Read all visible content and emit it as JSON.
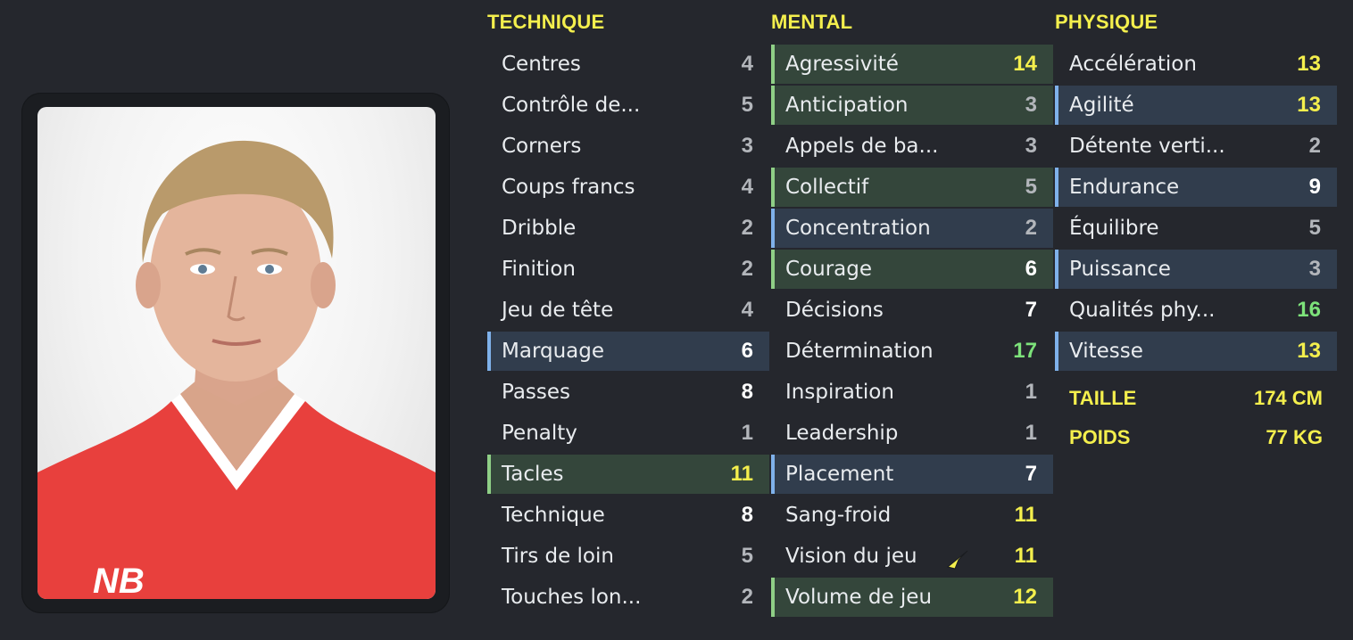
{
  "technique": {
    "title": "TECHNIQUE",
    "attributes": [
      {
        "label": "Centres",
        "value": "4",
        "tone": "gray",
        "hl": ""
      },
      {
        "label": "Contrôle de...",
        "value": "5",
        "tone": "gray",
        "hl": ""
      },
      {
        "label": "Corners",
        "value": "3",
        "tone": "gray",
        "hl": ""
      },
      {
        "label": "Coups francs",
        "value": "4",
        "tone": "gray",
        "hl": ""
      },
      {
        "label": "Dribble",
        "value": "2",
        "tone": "gray",
        "hl": ""
      },
      {
        "label": "Finition",
        "value": "2",
        "tone": "gray",
        "hl": ""
      },
      {
        "label": "Jeu de tête",
        "value": "4",
        "tone": "gray",
        "hl": ""
      },
      {
        "label": "Marquage",
        "value": "6",
        "tone": "white",
        "hl": "blue"
      },
      {
        "label": "Passes",
        "value": "8",
        "tone": "white",
        "hl": ""
      },
      {
        "label": "Penalty",
        "value": "1",
        "tone": "gray",
        "hl": ""
      },
      {
        "label": "Tacles",
        "value": "11",
        "tone": "yellow",
        "hl": "green"
      },
      {
        "label": "Technique",
        "value": "8",
        "tone": "white",
        "hl": ""
      },
      {
        "label": "Tirs de loin",
        "value": "5",
        "tone": "gray",
        "hl": ""
      },
      {
        "label": "Touches lon...",
        "value": "2",
        "tone": "gray",
        "hl": ""
      }
    ]
  },
  "mental": {
    "title": "MENTAL",
    "attributes": [
      {
        "label": "Agressivité",
        "value": "14",
        "tone": "yellow",
        "hl": "green"
      },
      {
        "label": "Anticipation",
        "value": "3",
        "tone": "gray",
        "hl": "green"
      },
      {
        "label": "Appels de ba...",
        "value": "3",
        "tone": "gray",
        "hl": ""
      },
      {
        "label": "Collectif",
        "value": "5",
        "tone": "gray",
        "hl": "green"
      },
      {
        "label": "Concentration",
        "value": "2",
        "tone": "gray",
        "hl": "blue"
      },
      {
        "label": "Courage",
        "value": "6",
        "tone": "white",
        "hl": "green"
      },
      {
        "label": "Décisions",
        "value": "7",
        "tone": "white",
        "hl": ""
      },
      {
        "label": "Détermination",
        "value": "17",
        "tone": "green",
        "hl": ""
      },
      {
        "label": "Inspiration",
        "value": "1",
        "tone": "gray",
        "hl": ""
      },
      {
        "label": "Leadership",
        "value": "1",
        "tone": "gray",
        "hl": ""
      },
      {
        "label": "Placement",
        "value": "7",
        "tone": "white",
        "hl": "blue"
      },
      {
        "label": "Sang-froid",
        "value": "11",
        "tone": "yellow",
        "hl": ""
      },
      {
        "label": "Vision du jeu",
        "value": "11",
        "tone": "yellow",
        "hl": ""
      },
      {
        "label": "Volume de jeu",
        "value": "12",
        "tone": "yellow",
        "hl": "green"
      }
    ]
  },
  "physique": {
    "title": "PHYSIQUE",
    "attributes": [
      {
        "label": "Accélération",
        "value": "13",
        "tone": "yellow",
        "hl": ""
      },
      {
        "label": "Agilité",
        "value": "13",
        "tone": "yellow",
        "hl": "blue"
      },
      {
        "label": "Détente verti...",
        "value": "2",
        "tone": "gray",
        "hl": ""
      },
      {
        "label": "Endurance",
        "value": "9",
        "tone": "white",
        "hl": "blue"
      },
      {
        "label": "Équilibre",
        "value": "5",
        "tone": "gray",
        "hl": ""
      },
      {
        "label": "Puissance",
        "value": "3",
        "tone": "gray",
        "hl": "blue"
      },
      {
        "label": "Qualités phy...",
        "value": "16",
        "tone": "green",
        "hl": ""
      },
      {
        "label": "Vitesse",
        "value": "13",
        "tone": "yellow",
        "hl": "blue"
      }
    ]
  },
  "body_info": {
    "height_label": "TAILLE",
    "height_value": "174 CM",
    "weight_label": "POIDS",
    "weight_value": "77 KG"
  },
  "colors": {
    "accent_yellow": "#f4ef4d",
    "good_green": "#7de27a",
    "highlight_green_bg": "#34463b",
    "highlight_blue_bg": "#313d4d"
  },
  "icons": {
    "cursor": "pointer-arrow-icon",
    "photo": "player-portrait"
  }
}
